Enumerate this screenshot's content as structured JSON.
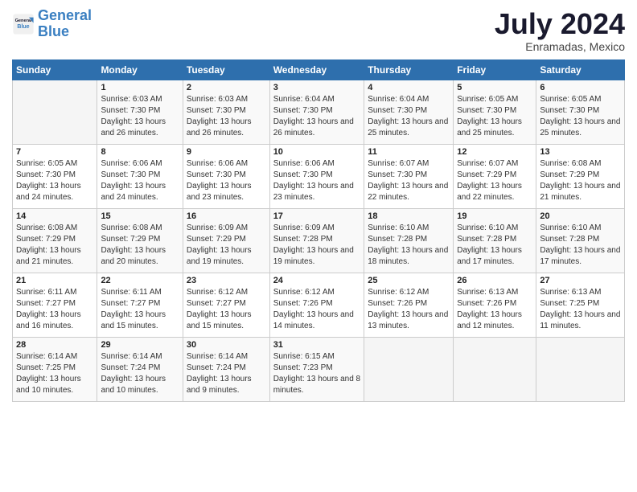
{
  "header": {
    "logo_line1": "General",
    "logo_line2": "Blue",
    "month_year": "July 2024",
    "location": "Enramadas, Mexico"
  },
  "days_of_week": [
    "Sunday",
    "Monday",
    "Tuesday",
    "Wednesday",
    "Thursday",
    "Friday",
    "Saturday"
  ],
  "weeks": [
    [
      {
        "day": null,
        "content": ""
      },
      {
        "day": "1",
        "content": "Sunrise: 6:03 AM\nSunset: 7:30 PM\nDaylight: 13 hours and 26 minutes."
      },
      {
        "day": "2",
        "content": "Sunrise: 6:03 AM\nSunset: 7:30 PM\nDaylight: 13 hours and 26 minutes."
      },
      {
        "day": "3",
        "content": "Sunrise: 6:04 AM\nSunset: 7:30 PM\nDaylight: 13 hours and 26 minutes."
      },
      {
        "day": "4",
        "content": "Sunrise: 6:04 AM\nSunset: 7:30 PM\nDaylight: 13 hours and 25 minutes."
      },
      {
        "day": "5",
        "content": "Sunrise: 6:05 AM\nSunset: 7:30 PM\nDaylight: 13 hours and 25 minutes."
      },
      {
        "day": "6",
        "content": "Sunrise: 6:05 AM\nSunset: 7:30 PM\nDaylight: 13 hours and 25 minutes."
      }
    ],
    [
      {
        "day": "7",
        "content": "Sunrise: 6:05 AM\nSunset: 7:30 PM\nDaylight: 13 hours and 24 minutes."
      },
      {
        "day": "8",
        "content": "Sunrise: 6:06 AM\nSunset: 7:30 PM\nDaylight: 13 hours and 24 minutes."
      },
      {
        "day": "9",
        "content": "Sunrise: 6:06 AM\nSunset: 7:30 PM\nDaylight: 13 hours and 23 minutes."
      },
      {
        "day": "10",
        "content": "Sunrise: 6:06 AM\nSunset: 7:30 PM\nDaylight: 13 hours and 23 minutes."
      },
      {
        "day": "11",
        "content": "Sunrise: 6:07 AM\nSunset: 7:30 PM\nDaylight: 13 hours and 22 minutes."
      },
      {
        "day": "12",
        "content": "Sunrise: 6:07 AM\nSunset: 7:29 PM\nDaylight: 13 hours and 22 minutes."
      },
      {
        "day": "13",
        "content": "Sunrise: 6:08 AM\nSunset: 7:29 PM\nDaylight: 13 hours and 21 minutes."
      }
    ],
    [
      {
        "day": "14",
        "content": "Sunrise: 6:08 AM\nSunset: 7:29 PM\nDaylight: 13 hours and 21 minutes."
      },
      {
        "day": "15",
        "content": "Sunrise: 6:08 AM\nSunset: 7:29 PM\nDaylight: 13 hours and 20 minutes."
      },
      {
        "day": "16",
        "content": "Sunrise: 6:09 AM\nSunset: 7:29 PM\nDaylight: 13 hours and 19 minutes."
      },
      {
        "day": "17",
        "content": "Sunrise: 6:09 AM\nSunset: 7:28 PM\nDaylight: 13 hours and 19 minutes."
      },
      {
        "day": "18",
        "content": "Sunrise: 6:10 AM\nSunset: 7:28 PM\nDaylight: 13 hours and 18 minutes."
      },
      {
        "day": "19",
        "content": "Sunrise: 6:10 AM\nSunset: 7:28 PM\nDaylight: 13 hours and 17 minutes."
      },
      {
        "day": "20",
        "content": "Sunrise: 6:10 AM\nSunset: 7:28 PM\nDaylight: 13 hours and 17 minutes."
      }
    ],
    [
      {
        "day": "21",
        "content": "Sunrise: 6:11 AM\nSunset: 7:27 PM\nDaylight: 13 hours and 16 minutes."
      },
      {
        "day": "22",
        "content": "Sunrise: 6:11 AM\nSunset: 7:27 PM\nDaylight: 13 hours and 15 minutes."
      },
      {
        "day": "23",
        "content": "Sunrise: 6:12 AM\nSunset: 7:27 PM\nDaylight: 13 hours and 15 minutes."
      },
      {
        "day": "24",
        "content": "Sunrise: 6:12 AM\nSunset: 7:26 PM\nDaylight: 13 hours and 14 minutes."
      },
      {
        "day": "25",
        "content": "Sunrise: 6:12 AM\nSunset: 7:26 PM\nDaylight: 13 hours and 13 minutes."
      },
      {
        "day": "26",
        "content": "Sunrise: 6:13 AM\nSunset: 7:26 PM\nDaylight: 13 hours and 12 minutes."
      },
      {
        "day": "27",
        "content": "Sunrise: 6:13 AM\nSunset: 7:25 PM\nDaylight: 13 hours and 11 minutes."
      }
    ],
    [
      {
        "day": "28",
        "content": "Sunrise: 6:14 AM\nSunset: 7:25 PM\nDaylight: 13 hours and 10 minutes."
      },
      {
        "day": "29",
        "content": "Sunrise: 6:14 AM\nSunset: 7:24 PM\nDaylight: 13 hours and 10 minutes."
      },
      {
        "day": "30",
        "content": "Sunrise: 6:14 AM\nSunset: 7:24 PM\nDaylight: 13 hours and 9 minutes."
      },
      {
        "day": "31",
        "content": "Sunrise: 6:15 AM\nSunset: 7:23 PM\nDaylight: 13 hours and 8 minutes."
      },
      {
        "day": null,
        "content": ""
      },
      {
        "day": null,
        "content": ""
      },
      {
        "day": null,
        "content": ""
      }
    ]
  ]
}
